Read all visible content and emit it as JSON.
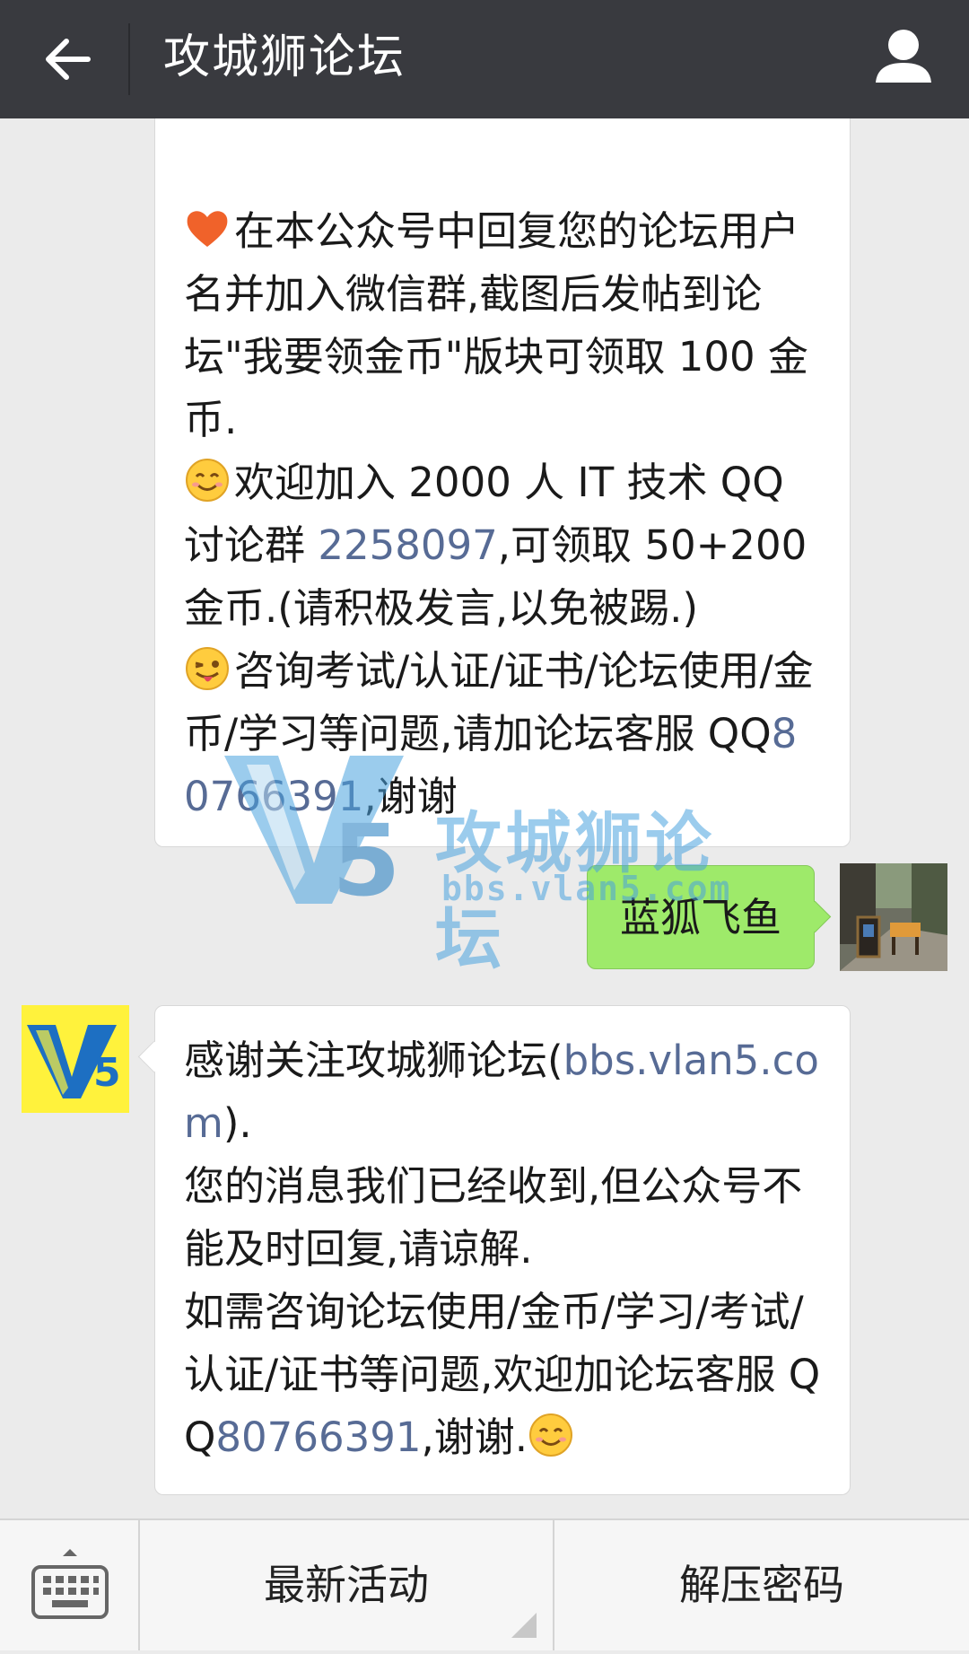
{
  "header": {
    "title": "攻城狮论坛"
  },
  "messages": {
    "intro": {
      "line1": "在本公众号中回复您的论坛用户名并加入微信群,截图后发帖到论坛\"我要领金币\"版块可领取 100 金币.",
      "line2_a": "欢迎加入 2000 人 IT 技术 QQ 讨论群 ",
      "line2_link": "2258097",
      "line2_b": ",可领取 50+200 金币.(请积极发言,以免被踢.)",
      "line3_a": "咨询考试/认证/证书/论坛使用/金币/学习等问题,请加论坛客服 QQ",
      "line3_link": "80766391",
      "line3_b": ",谢谢"
    },
    "user_message": "蓝狐飞鱼",
    "reply": {
      "p1_a": "感谢关注攻城狮论坛(",
      "p1_link": "bbs.vlan5.com",
      "p1_b": ").",
      "p2": "您的消息我们已经收到,但公众号不能及时回复,请谅解.",
      "p3_a": "如需咨询论坛使用/金币/学习/考试/认证/证书等问题,欢迎加论坛客服 QQ",
      "p3_link": "80766391",
      "p3_b": ",谢谢."
    }
  },
  "watermark": {
    "logo_text": "V5",
    "name": "攻城狮论坛",
    "url": "bbs.vlan5.com"
  },
  "bottom_menu": {
    "item1": "最新活动",
    "item2": "解压密码"
  },
  "colors": {
    "topbar": "#393a3f",
    "link": "#576b95",
    "outgoing_bubble": "#9eea6a",
    "background": "#ebebeb"
  },
  "icons": {
    "back": "arrow-left-icon",
    "profile": "person-icon",
    "keyboard": "keyboard-icon",
    "heart": "heart-emoji",
    "smile": "smile-emoji",
    "wink": "wink-tongue-emoji"
  }
}
